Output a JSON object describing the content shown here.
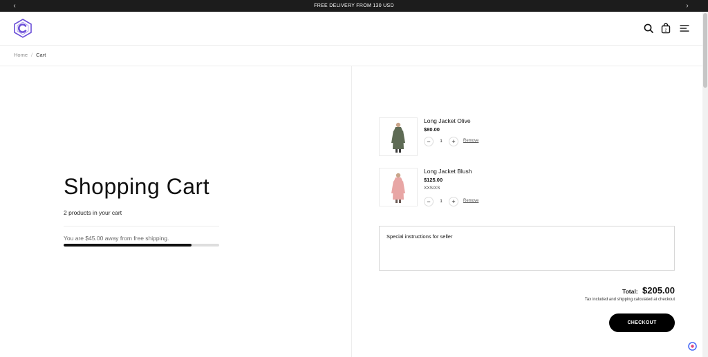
{
  "announcement": {
    "text": "FREE DELIVERY FROM 130 USD",
    "prev_icon": "chevron-left-icon",
    "next_icon": "chevron-right-icon"
  },
  "header": {
    "logo": "brand-logo",
    "icons": [
      "search-icon",
      "shopping-bag-icon",
      "menu-icon"
    ],
    "bag_count": "2"
  },
  "breadcrumb": {
    "home": "Home",
    "separator": "/",
    "current": "Cart"
  },
  "cart": {
    "title": "Shopping Cart",
    "count_text": "2 products in your cart",
    "shipping_text": "You are $45.00 away from free shipping.",
    "shipping_progress": 0.82
  },
  "items": [
    {
      "name": "Long Jacket Olive",
      "price": "$80.00",
      "variant": "",
      "qty": "1",
      "remove": "Remove",
      "color": "#5e6b55"
    },
    {
      "name": "Long Jacket Blush",
      "price": "$125.00",
      "variant": "XXS/XS",
      "qty": "1",
      "remove": "Remove",
      "color": "#e8a6a5"
    }
  ],
  "notes": {
    "placeholder": "Special instructions for seller"
  },
  "summary": {
    "total_label": "Total:",
    "total_value": "$205.00",
    "tax_note": "Tax included and shipping calculated at checkout",
    "checkout_label": "CHECKOUT"
  },
  "colors": {
    "accent": "#6b4fd8",
    "dark": "#000000",
    "bar": "#1c1c1c"
  }
}
